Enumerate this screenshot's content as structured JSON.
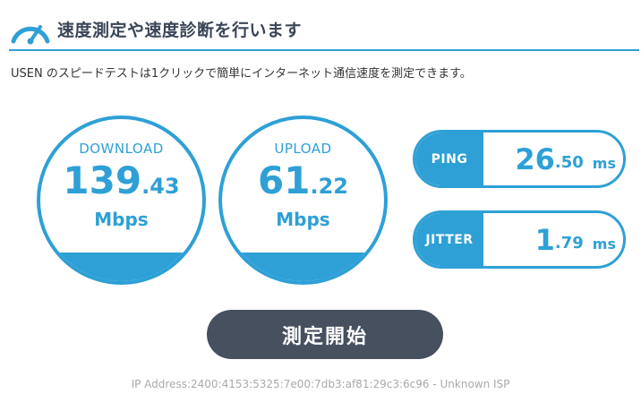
{
  "header": {
    "title": "速度測定や速度診断を行います",
    "description": "USEN のスピードテストは1クリックで簡単にインターネット通信速度を測定できます。",
    "accent_color": "#2ea0d6",
    "icon": "speedometer-icon"
  },
  "download": {
    "label": "DOWNLOAD",
    "int": "139",
    "dec": ".43",
    "unit": "Mbps"
  },
  "upload": {
    "label": "UPLOAD",
    "int": "61",
    "dec": ".22",
    "unit": "Mbps"
  },
  "ping": {
    "label": "PING",
    "int": "26",
    "dec": ".50",
    "unit": "ms"
  },
  "jitter": {
    "label": "JITTER",
    "int": "1",
    "dec": ".79",
    "unit": "ms"
  },
  "start_button": {
    "label": "測定開始",
    "color": "#46505f"
  },
  "footer": {
    "ip_text": "IP Address:2400:4153:5325:7e00:7db3:af81:29c3:6c96 - Unknown ISP"
  }
}
